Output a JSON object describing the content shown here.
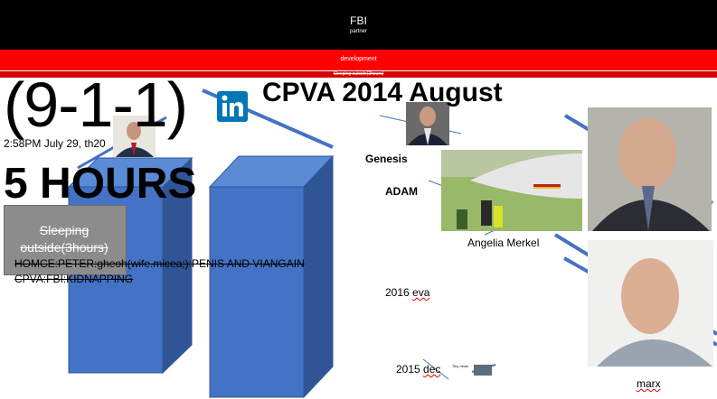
{
  "header": {
    "title": "FBI",
    "subtitle": "partner"
  },
  "banner": {
    "label": "development",
    "sleeping_tiny": "Sleeping outside(3hours)"
  },
  "slide": {
    "number_911": "(9-1-1)",
    "headline": "CPVA 2014 August",
    "datetime": "2:58PM July 29, th20",
    "hours": "5 HOURS",
    "sleeping_box": "Sleeping outside(3hours)",
    "homce_line": "HOMCE:PETER:gheoh(wife.micea;):PENIS AND VIANGAIN",
    "cpva_fbi_line": "CPVA:FBI:KIDNAPPING",
    "genesis": "Genesis",
    "adam": "ADAM",
    "merkel": "Angelia Merkel",
    "eva_year": "2016",
    "eva_word": "eva",
    "dec_year": "2015",
    "dec_word": "dec",
    "marx": "marx",
    "tiny_news": "Tiny news"
  },
  "icons": {
    "linkedin": "linkedin-icon"
  },
  "colors": {
    "top_bar": "#000000",
    "red_bar": "#ff0000",
    "column_front": "#4472c4",
    "column_side": "#2f5597",
    "line": "#4472c4",
    "linkedin": "#0077b5"
  }
}
